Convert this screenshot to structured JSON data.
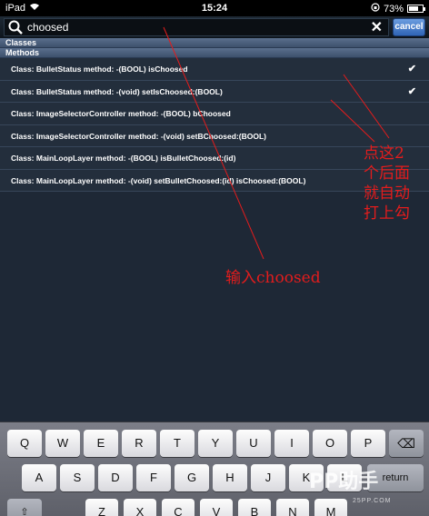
{
  "status_bar": {
    "device": "iPad",
    "time": "15:24",
    "battery": "73%",
    "battery_level": 0.73
  },
  "search": {
    "value": "choosed",
    "cancel_label": "cancel"
  },
  "sections": [
    {
      "title": "Classes",
      "items": []
    },
    {
      "title": "Methods",
      "items": [
        {
          "label": "Class: BulletStatus method: -(BOOL) isChoosed",
          "checked": true
        },
        {
          "label": "Class: BulletStatus method: -(void) setIsChoosed:(BOOL)",
          "checked": true
        },
        {
          "label": "Class: ImageSelectorController method: -(BOOL) bChoosed",
          "checked": false
        },
        {
          "label": "Class: ImageSelectorController method: -(void) setBChoosed:(BOOL)",
          "checked": false
        },
        {
          "label": "Class: MainLoopLayer method: -(BOOL) isBulletChoosed:(id)",
          "checked": false
        },
        {
          "label": "Class: MainLoopLayer method: -(void) setBulletChoosed:(id) isChoosed:(BOOL)",
          "checked": false
        }
      ]
    }
  ],
  "annotations": {
    "right_note": [
      "点这2",
      "个后面",
      "就自动",
      "打上勾"
    ],
    "input_note": "输入choosed"
  },
  "keyboard": {
    "row1": [
      "Q",
      "W",
      "E",
      "R",
      "T",
      "Y",
      "U",
      "I",
      "O",
      "P"
    ],
    "row2": [
      "A",
      "S",
      "D",
      "F",
      "G",
      "H",
      "J",
      "K",
      "L"
    ],
    "row3": [
      "Z",
      "X",
      "C",
      "V",
      "B",
      "N",
      "M"
    ],
    "return_label": "return"
  },
  "watermark": {
    "text": "PP助手",
    "sub": "25PP.COM"
  },
  "colors": {
    "annotation": "#e41c1c",
    "background": "#1e2836"
  }
}
